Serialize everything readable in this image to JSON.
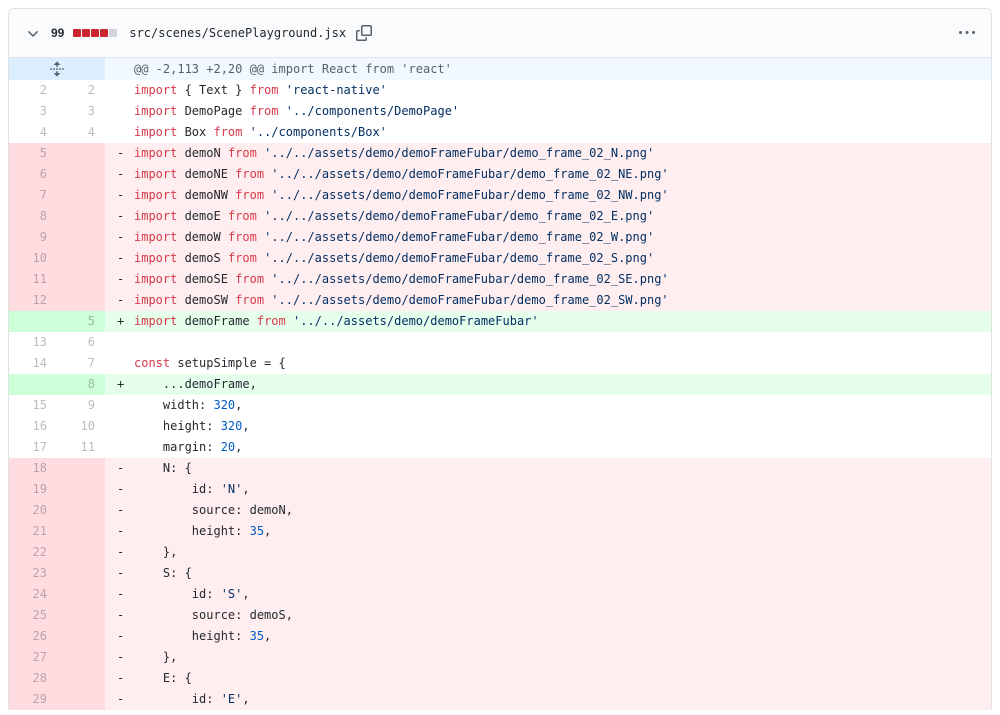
{
  "header": {
    "changes_count": "99",
    "file_path": "src/scenes/ScenePlayground.jsx",
    "diffstat_blocks": [
      "deleted",
      "deleted",
      "deleted",
      "deleted",
      "neutral"
    ]
  },
  "hunk": {
    "text": "@@ -2,113 +2,20 @@ import React from 'react'"
  },
  "icons": {
    "toggle": "chevron-down-icon",
    "copy": "copy-icon",
    "menu": "kebab-horizontal-icon",
    "expand": "unfold-icon"
  },
  "colors": {
    "keyword": "#d73a49",
    "string": "#032f62",
    "number": "#005cc5",
    "text": "#24292e",
    "addition_bg": "#e6ffed",
    "addition_num_bg": "#cdffd8",
    "deletion_bg": "#ffeef0",
    "deletion_num_bg": "#ffdce0",
    "hunk_bg": "#f1f8ff",
    "hunk_num_bg": "#dbedff",
    "diffstat_deleted": "#cb2431",
    "diffstat_neutral": "#d1d5da"
  },
  "diff": {
    "lines": [
      {
        "o": "2",
        "n": "2",
        "t": "ctx",
        "seg": [
          [
            "k",
            "import"
          ],
          [
            "p",
            " { Text } "
          ],
          [
            "k",
            "from"
          ],
          [
            "p",
            " "
          ],
          [
            "s",
            "'react-native'"
          ]
        ]
      },
      {
        "o": "3",
        "n": "3",
        "t": "ctx",
        "seg": [
          [
            "k",
            "import"
          ],
          [
            "p",
            " DemoPage "
          ],
          [
            "k",
            "from"
          ],
          [
            "p",
            " "
          ],
          [
            "s",
            "'../components/DemoPage'"
          ]
        ]
      },
      {
        "o": "4",
        "n": "4",
        "t": "ctx",
        "seg": [
          [
            "k",
            "import"
          ],
          [
            "p",
            " Box "
          ],
          [
            "k",
            "from"
          ],
          [
            "p",
            " "
          ],
          [
            "s",
            "'../components/Box'"
          ]
        ]
      },
      {
        "o": "5",
        "n": "",
        "t": "del",
        "seg": [
          [
            "k",
            "import"
          ],
          [
            "p",
            " demoN "
          ],
          [
            "k",
            "from"
          ],
          [
            "p",
            " "
          ],
          [
            "s",
            "'../../assets/demo/demoFrameFubar/demo_frame_02_N.png'"
          ]
        ]
      },
      {
        "o": "6",
        "n": "",
        "t": "del",
        "seg": [
          [
            "k",
            "import"
          ],
          [
            "p",
            " demoNE "
          ],
          [
            "k",
            "from"
          ],
          [
            "p",
            " "
          ],
          [
            "s",
            "'../../assets/demo/demoFrameFubar/demo_frame_02_NE.png'"
          ]
        ]
      },
      {
        "o": "7",
        "n": "",
        "t": "del",
        "seg": [
          [
            "k",
            "import"
          ],
          [
            "p",
            " demoNW "
          ],
          [
            "k",
            "from"
          ],
          [
            "p",
            " "
          ],
          [
            "s",
            "'../../assets/demo/demoFrameFubar/demo_frame_02_NW.png'"
          ]
        ]
      },
      {
        "o": "8",
        "n": "",
        "t": "del",
        "seg": [
          [
            "k",
            "import"
          ],
          [
            "p",
            " demoE "
          ],
          [
            "k",
            "from"
          ],
          [
            "p",
            " "
          ],
          [
            "s",
            "'../../assets/demo/demoFrameFubar/demo_frame_02_E.png'"
          ]
        ]
      },
      {
        "o": "9",
        "n": "",
        "t": "del",
        "seg": [
          [
            "k",
            "import"
          ],
          [
            "p",
            " demoW "
          ],
          [
            "k",
            "from"
          ],
          [
            "p",
            " "
          ],
          [
            "s",
            "'../../assets/demo/demoFrameFubar/demo_frame_02_W.png'"
          ]
        ]
      },
      {
        "o": "10",
        "n": "",
        "t": "del",
        "seg": [
          [
            "k",
            "import"
          ],
          [
            "p",
            " demoS "
          ],
          [
            "k",
            "from"
          ],
          [
            "p",
            " "
          ],
          [
            "s",
            "'../../assets/demo/demoFrameFubar/demo_frame_02_S.png'"
          ]
        ]
      },
      {
        "o": "11",
        "n": "",
        "t": "del",
        "seg": [
          [
            "k",
            "import"
          ],
          [
            "p",
            " demoSE "
          ],
          [
            "k",
            "from"
          ],
          [
            "p",
            " "
          ],
          [
            "s",
            "'../../assets/demo/demoFrameFubar/demo_frame_02_SE.png'"
          ]
        ]
      },
      {
        "o": "12",
        "n": "",
        "t": "del",
        "seg": [
          [
            "k",
            "import"
          ],
          [
            "p",
            " demoSW "
          ],
          [
            "k",
            "from"
          ],
          [
            "p",
            " "
          ],
          [
            "s",
            "'../../assets/demo/demoFrameFubar/demo_frame_02_SW.png'"
          ]
        ]
      },
      {
        "o": "",
        "n": "5",
        "t": "add",
        "seg": [
          [
            "k",
            "import"
          ],
          [
            "p",
            " demoFrame "
          ],
          [
            "k",
            "from"
          ],
          [
            "p",
            " "
          ],
          [
            "s",
            "'../../assets/demo/demoFrameFubar'"
          ]
        ]
      },
      {
        "o": "13",
        "n": "6",
        "t": "ctx",
        "seg": []
      },
      {
        "o": "14",
        "n": "7",
        "t": "ctx",
        "seg": [
          [
            "k",
            "const"
          ],
          [
            "p",
            " setupSimple = {"
          ]
        ]
      },
      {
        "o": "",
        "n": "8",
        "t": "add",
        "seg": [
          [
            "p",
            "    ...demoFrame,"
          ]
        ]
      },
      {
        "o": "15",
        "n": "9",
        "t": "ctx",
        "seg": [
          [
            "p",
            "    width: "
          ],
          [
            "num",
            "320"
          ],
          [
            "p",
            ","
          ]
        ]
      },
      {
        "o": "16",
        "n": "10",
        "t": "ctx",
        "seg": [
          [
            "p",
            "    height: "
          ],
          [
            "num",
            "320"
          ],
          [
            "p",
            ","
          ]
        ]
      },
      {
        "o": "17",
        "n": "11",
        "t": "ctx",
        "seg": [
          [
            "p",
            "    margin: "
          ],
          [
            "num",
            "20"
          ],
          [
            "p",
            ","
          ]
        ]
      },
      {
        "o": "18",
        "n": "",
        "t": "del",
        "seg": [
          [
            "p",
            "    N: {"
          ]
        ]
      },
      {
        "o": "19",
        "n": "",
        "t": "del",
        "seg": [
          [
            "p",
            "        id: "
          ],
          [
            "s",
            "'N'"
          ],
          [
            "p",
            ","
          ]
        ]
      },
      {
        "o": "20",
        "n": "",
        "t": "del",
        "seg": [
          [
            "p",
            "        source: demoN,"
          ]
        ]
      },
      {
        "o": "21",
        "n": "",
        "t": "del",
        "seg": [
          [
            "p",
            "        height: "
          ],
          [
            "num",
            "35"
          ],
          [
            "p",
            ","
          ]
        ]
      },
      {
        "o": "22",
        "n": "",
        "t": "del",
        "seg": [
          [
            "p",
            "    },"
          ]
        ]
      },
      {
        "o": "23",
        "n": "",
        "t": "del",
        "seg": [
          [
            "p",
            "    S: {"
          ]
        ]
      },
      {
        "o": "24",
        "n": "",
        "t": "del",
        "seg": [
          [
            "p",
            "        id: "
          ],
          [
            "s",
            "'S'"
          ],
          [
            "p",
            ","
          ]
        ]
      },
      {
        "o": "25",
        "n": "",
        "t": "del",
        "seg": [
          [
            "p",
            "        source: demoS,"
          ]
        ]
      },
      {
        "o": "26",
        "n": "",
        "t": "del",
        "seg": [
          [
            "p",
            "        height: "
          ],
          [
            "num",
            "35"
          ],
          [
            "p",
            ","
          ]
        ]
      },
      {
        "o": "27",
        "n": "",
        "t": "del",
        "seg": [
          [
            "p",
            "    },"
          ]
        ]
      },
      {
        "o": "28",
        "n": "",
        "t": "del",
        "seg": [
          [
            "p",
            "    E: {"
          ]
        ]
      },
      {
        "o": "29",
        "n": "",
        "t": "del",
        "seg": [
          [
            "p",
            "        id: "
          ],
          [
            "s",
            "'E'"
          ],
          [
            "p",
            ","
          ]
        ]
      }
    ]
  }
}
